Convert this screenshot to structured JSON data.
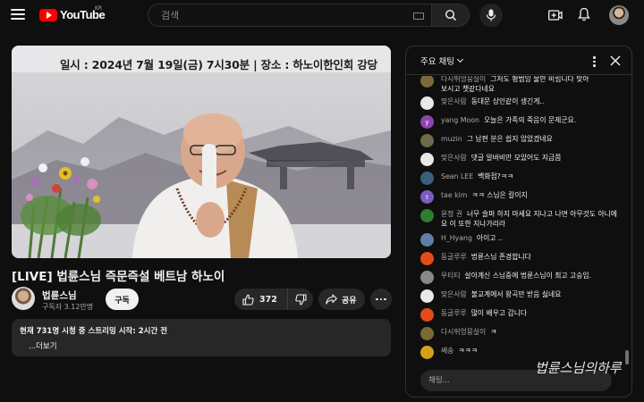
{
  "header": {
    "logo_text": "YouTube",
    "region": "KR",
    "search_placeholder": "검색",
    "icons": [
      "menu-icon",
      "search-icon",
      "mic-icon",
      "create-icon",
      "bell-icon"
    ]
  },
  "video": {
    "banner_text": "일시 : 2024년 7월 19일(금) 7시30분  |  장소 : 하노이한인회 강당",
    "title": "[LIVE] 법륜스님 즉문즉설 베트남 하노이",
    "channel": "법륜스님",
    "subscribers": "구독자 3.12만명",
    "subscribe_label": "구독",
    "likes": "372",
    "share_label": "공유",
    "stats": "현재 731명 시청 중  스트리밍 시작: 2시간 전",
    "more_label": "...더보기"
  },
  "chat": {
    "mode_label": "주요 채팅",
    "input_placeholder": "채팅...",
    "messages": [
      {
        "author": "다시뛰엉뭉실이",
        "text": "그저도 평범잉 물만 비립니다 맞아",
        "avatar_color": "#7a6a3a"
      },
      {
        "author": "",
        "text": "보시고 챗같다네요",
        "avatar_color": ""
      },
      {
        "author": "맞은사람",
        "text": "동대문 상인같이 생긴게..",
        "avatar_color": "#e8e8e8"
      },
      {
        "author": "yang Moon",
        "text": "오늘은 가족의 죽음이 문제군요.",
        "avatar_color": "#8e44ad"
      },
      {
        "author": "muzin",
        "text": "그 남편 분은 쉽지 않았겠네요",
        "avatar_color": "#6b6b4a"
      },
      {
        "author": "맞은사람",
        "text": "댓글 알바비만 모았어도 지금쯤",
        "avatar_color": "#e8e8e8"
      },
      {
        "author": "Sean LEE",
        "text": "백화점?ㅋㅋ",
        "avatar_color": "#3a5f7a"
      },
      {
        "author": "tae kim",
        "text": "ㅋㅋ 스님은 칼이지",
        "avatar_color": "#7b5cc4"
      },
      {
        "author": "윤정 권",
        "text": "너무 슬퍼 하지 마세요 지나고 나면 아무것도 아니에요 이 또한 지나가리라",
        "avatar_color": "#2e7d32"
      },
      {
        "author": "H_Hyang",
        "text": "아이고 ..",
        "avatar_color": "#5d7fa8"
      },
      {
        "author": "동글루루",
        "text": "법륜스님 존경합니다",
        "avatar_color": "#e64a19"
      },
      {
        "author": "우티티",
        "text": "살아계신 스님중에 법륜스님이 최고 고승임.",
        "avatar_color": "#888888"
      },
      {
        "author": "맞은사람",
        "text": "불교계에서 왕곡만 받음 싫네요",
        "avatar_color": "#e8e8e8"
      },
      {
        "author": "동글루루",
        "text": "많이 배우고 갑니다",
        "avatar_color": "#e64a19"
      },
      {
        "author": "다시뛰엉뭉실이",
        "text": "ㅋ",
        "avatar_color": "#7a6a3a"
      },
      {
        "author": "쎄송",
        "text": "ㅋㅋㅋ",
        "avatar_color": "#d4a017"
      }
    ],
    "watermark": "법륜스님의하루"
  }
}
